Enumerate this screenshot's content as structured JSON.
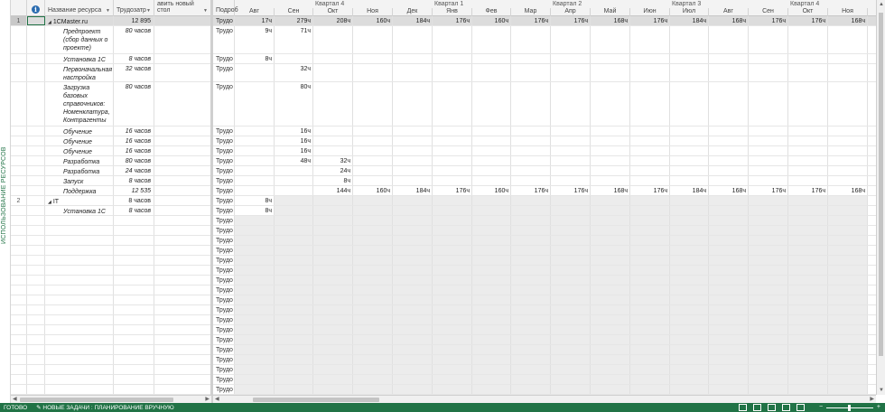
{
  "side_label": "ИСПОЛЬЗОВАНИЕ РЕСУРСОВ",
  "columns": {
    "info": "i",
    "name": "Название ресурса",
    "work": "Трудозатр",
    "add": "авить новый стол",
    "detail": "Подроб"
  },
  "timescale": {
    "quarters": [
      "Квартал 4",
      "Квартал 1",
      "Квартал 2",
      "Квартал 3",
      "Квартал 4"
    ],
    "months": [
      "Авг",
      "Сен",
      "Окт",
      "Ноя",
      "Дек",
      "Янв",
      "Фев",
      "Мар",
      "Апр",
      "Май",
      "Июн",
      "Июл",
      "Авг",
      "Сен",
      "Окт",
      "Ноя"
    ]
  },
  "rows": [
    {
      "id": "1",
      "name": "1CMaster.ru",
      "work": "12 895 часов",
      "detail": "Трудо",
      "cells": [
        "17ч",
        "279ч",
        "208ч",
        "160ч",
        "184ч",
        "176ч",
        "160ч",
        "176ч",
        "176ч",
        "168ч",
        "176ч",
        "184ч",
        "168ч",
        "176ч",
        "176ч",
        "168ч"
      ]
    },
    {
      "id": "",
      "name": "Предпроект (сбор данных о проекте)",
      "work": "80 часов",
      "detail": "Трудо",
      "cells": [
        "9ч",
        "71ч"
      ]
    },
    {
      "id": "",
      "name": "Установка 1С",
      "work": "8 часов",
      "detail": "Трудо",
      "cells": [
        "8ч"
      ]
    },
    {
      "id": "",
      "name": "Первоначальная настройка",
      "work": "32 часов",
      "detail": "Трудо",
      "cells": [
        "",
        "32ч"
      ]
    },
    {
      "id": "",
      "name": "Загрузка базовых справочников: Номенклатура, Контрагенты",
      "work": "80 часов",
      "detail": "Трудо",
      "cells": [
        "",
        "80ч"
      ]
    },
    {
      "id": "",
      "name": "Обучение",
      "work": "16 часов",
      "detail": "Трудо",
      "cells": [
        "",
        "16ч"
      ]
    },
    {
      "id": "",
      "name": "Обучение",
      "work": "16 часов",
      "detail": "Трудо",
      "cells": [
        "",
        "16ч"
      ]
    },
    {
      "id": "",
      "name": "Обучение",
      "work": "16 часов",
      "detail": "Трудо",
      "cells": [
        "",
        "16ч"
      ]
    },
    {
      "id": "",
      "name": "Разработка",
      "work": "80 часов",
      "detail": "Трудо",
      "cells": [
        "",
        "48ч",
        "32ч"
      ]
    },
    {
      "id": "",
      "name": "Разработка",
      "work": "24 часов",
      "detail": "Трудо",
      "cells": [
        "",
        "",
        "24ч"
      ]
    },
    {
      "id": "",
      "name": "Запуск",
      "work": "8 часов",
      "detail": "Трудо",
      "cells": [
        "",
        "",
        "8ч"
      ]
    },
    {
      "id": "",
      "name": "Поддержка",
      "work": "12 535 часов",
      "detail": "Трудо",
      "cells": [
        "",
        "",
        "144ч",
        "160ч",
        "184ч",
        "176ч",
        "160ч",
        "176ч",
        "176ч",
        "168ч",
        "176ч",
        "184ч",
        "168ч",
        "176ч",
        "176ч",
        "168ч"
      ]
    },
    {
      "id": "2",
      "name": "IT",
      "work": "8 часов",
      "detail": "Трудо",
      "cells": [
        "8ч"
      ]
    },
    {
      "id": "",
      "name": "Установка 1С",
      "work": "8 часов",
      "detail": "Трудо",
      "cells": [
        "8ч"
      ]
    }
  ],
  "empty_detail": "Трудо",
  "status": {
    "ready": "ГОТОВО",
    "new_tasks": "НОВЫЕ ЗАДАЧИ : ПЛАНИРОВАНИЕ ВРУЧНУЮ"
  },
  "colors": {
    "accent": "#217346",
    "selection": "#dcdcdc",
    "nonworking": "#ececec"
  }
}
